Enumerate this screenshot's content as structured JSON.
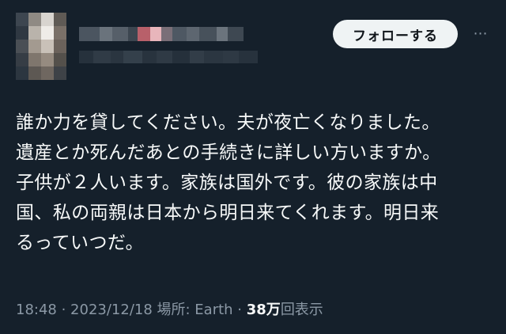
{
  "colors": {
    "background": "#15202b",
    "text": "#f7f9f9",
    "muted": "#8b98a5",
    "follow_bg": "#eff3f4",
    "follow_text": "#0f1419"
  },
  "header": {
    "avatar": "pixelated-avatar",
    "display_name": "pixelated",
    "handle": "pixelated",
    "follow_label": "フォローする",
    "more_icon": "⋯"
  },
  "tweet": {
    "lines": [
      "誰か力を貸してください。夫が夜亡くなりました。",
      "遺産とか死んだあとの手続きに詳しい方いますか。",
      "子供が２人います。家族は国外です。彼の家族は中",
      "国、私の両親は日本から明日来てくれます。明日来",
      "るっていつだ。"
    ]
  },
  "meta": {
    "time": "18:48",
    "sep1": " · ",
    "date": "2023/12/18",
    "location": " 場所: Earth",
    "sep2": " · ",
    "views_count": "38万",
    "views_label": "回表示"
  }
}
